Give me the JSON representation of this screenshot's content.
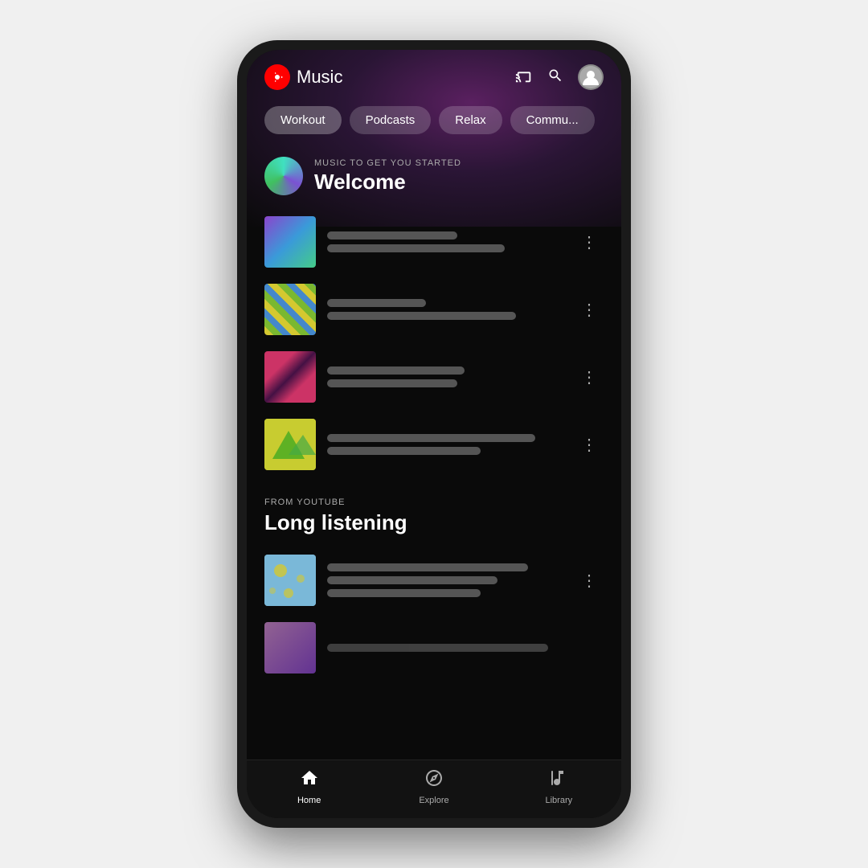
{
  "app": {
    "name": "Music",
    "logo_label": "YT Music Logo"
  },
  "header": {
    "cast_icon": "cast",
    "search_icon": "search",
    "avatar_icon": "account"
  },
  "categories": [
    {
      "id": "workout",
      "label": "Workout",
      "active": true
    },
    {
      "id": "podcasts",
      "label": "Podcasts",
      "active": false
    },
    {
      "id": "relax",
      "label": "Relax",
      "active": false
    },
    {
      "id": "community",
      "label": "Commu...",
      "active": false
    }
  ],
  "section1": {
    "subtitle": "MUSIC TO GET YOU STARTED",
    "title": "Welcome",
    "tracks": [
      {
        "id": 1,
        "art_class": "art-1",
        "line1_width": "55%",
        "line2_width": "75%"
      },
      {
        "id": 2,
        "art_class": "art-2",
        "line1_width": "42%",
        "line2_width": "80%"
      },
      {
        "id": 3,
        "art_class": "art-3",
        "line1_width": "58%",
        "line2_width": "55%"
      },
      {
        "id": 4,
        "art_class": "art-4",
        "line1_width": "88%",
        "line2_width": "65%"
      }
    ]
  },
  "section2": {
    "subtitle": "FROM YOUTUBE",
    "title": "Long listening",
    "tracks": [
      {
        "id": 5,
        "art_class": "art-5",
        "line1_width": "85%",
        "line2_width": "72%",
        "line3_width": "65%"
      },
      {
        "id": 6,
        "art_class": "art-6",
        "line1_width": "80%",
        "line2_width": "0%"
      }
    ]
  },
  "bottom_nav": [
    {
      "id": "home",
      "label": "Home",
      "icon": "home",
      "active": true
    },
    {
      "id": "explore",
      "label": "Explore",
      "icon": "explore",
      "active": false
    },
    {
      "id": "library",
      "label": "Library",
      "icon": "library",
      "active": false
    }
  ]
}
